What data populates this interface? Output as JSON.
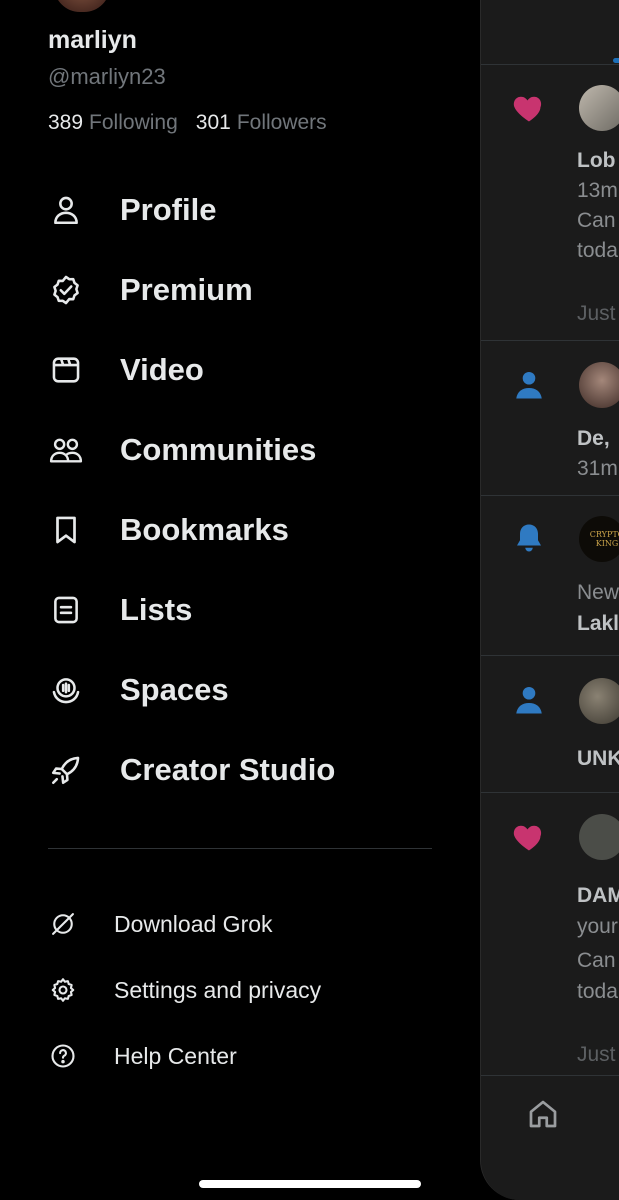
{
  "profile": {
    "display_name": "marliyn",
    "handle": "@marliyn23",
    "following_count": "389",
    "following_label": "Following",
    "followers_count": "301",
    "followers_label": "Followers"
  },
  "menu": [
    {
      "label": "Profile",
      "icon": "person-icon"
    },
    {
      "label": "Premium",
      "icon": "verified-badge-icon"
    },
    {
      "label": "Video",
      "icon": "video-icon"
    },
    {
      "label": "Communities",
      "icon": "communities-icon"
    },
    {
      "label": "Bookmarks",
      "icon": "bookmark-icon"
    },
    {
      "label": "Lists",
      "icon": "lists-icon"
    },
    {
      "label": "Spaces",
      "icon": "spaces-icon"
    },
    {
      "label": "Creator Studio",
      "icon": "rocket-icon"
    }
  ],
  "secondary_menu": [
    {
      "label": "Download Grok",
      "icon": "grok-icon"
    },
    {
      "label": "Settings and privacy",
      "icon": "gear-icon"
    },
    {
      "label": "Help Center",
      "icon": "help-icon"
    }
  ],
  "feed": {
    "notifications": [
      {
        "icon": "heart-icon",
        "lines": [
          "Lob",
          "13m",
          "Can",
          "toda",
          "Just"
        ]
      },
      {
        "icon": "person-icon",
        "lines": [
          "De,",
          "31m"
        ]
      },
      {
        "icon": "bell-icon",
        "avatar_text": "CRYPTO KING",
        "lines": [
          "New",
          "Lakl"
        ]
      },
      {
        "icon": "person-icon",
        "lines": [
          "UNK"
        ]
      },
      {
        "icon": "heart-icon",
        "lines": [
          "DAM",
          "your",
          "Can",
          "toda",
          "Just"
        ]
      }
    ],
    "colors": {
      "heart": "#c8346f",
      "person": "#2f7ac2",
      "bell": "#2f7ac2"
    }
  }
}
